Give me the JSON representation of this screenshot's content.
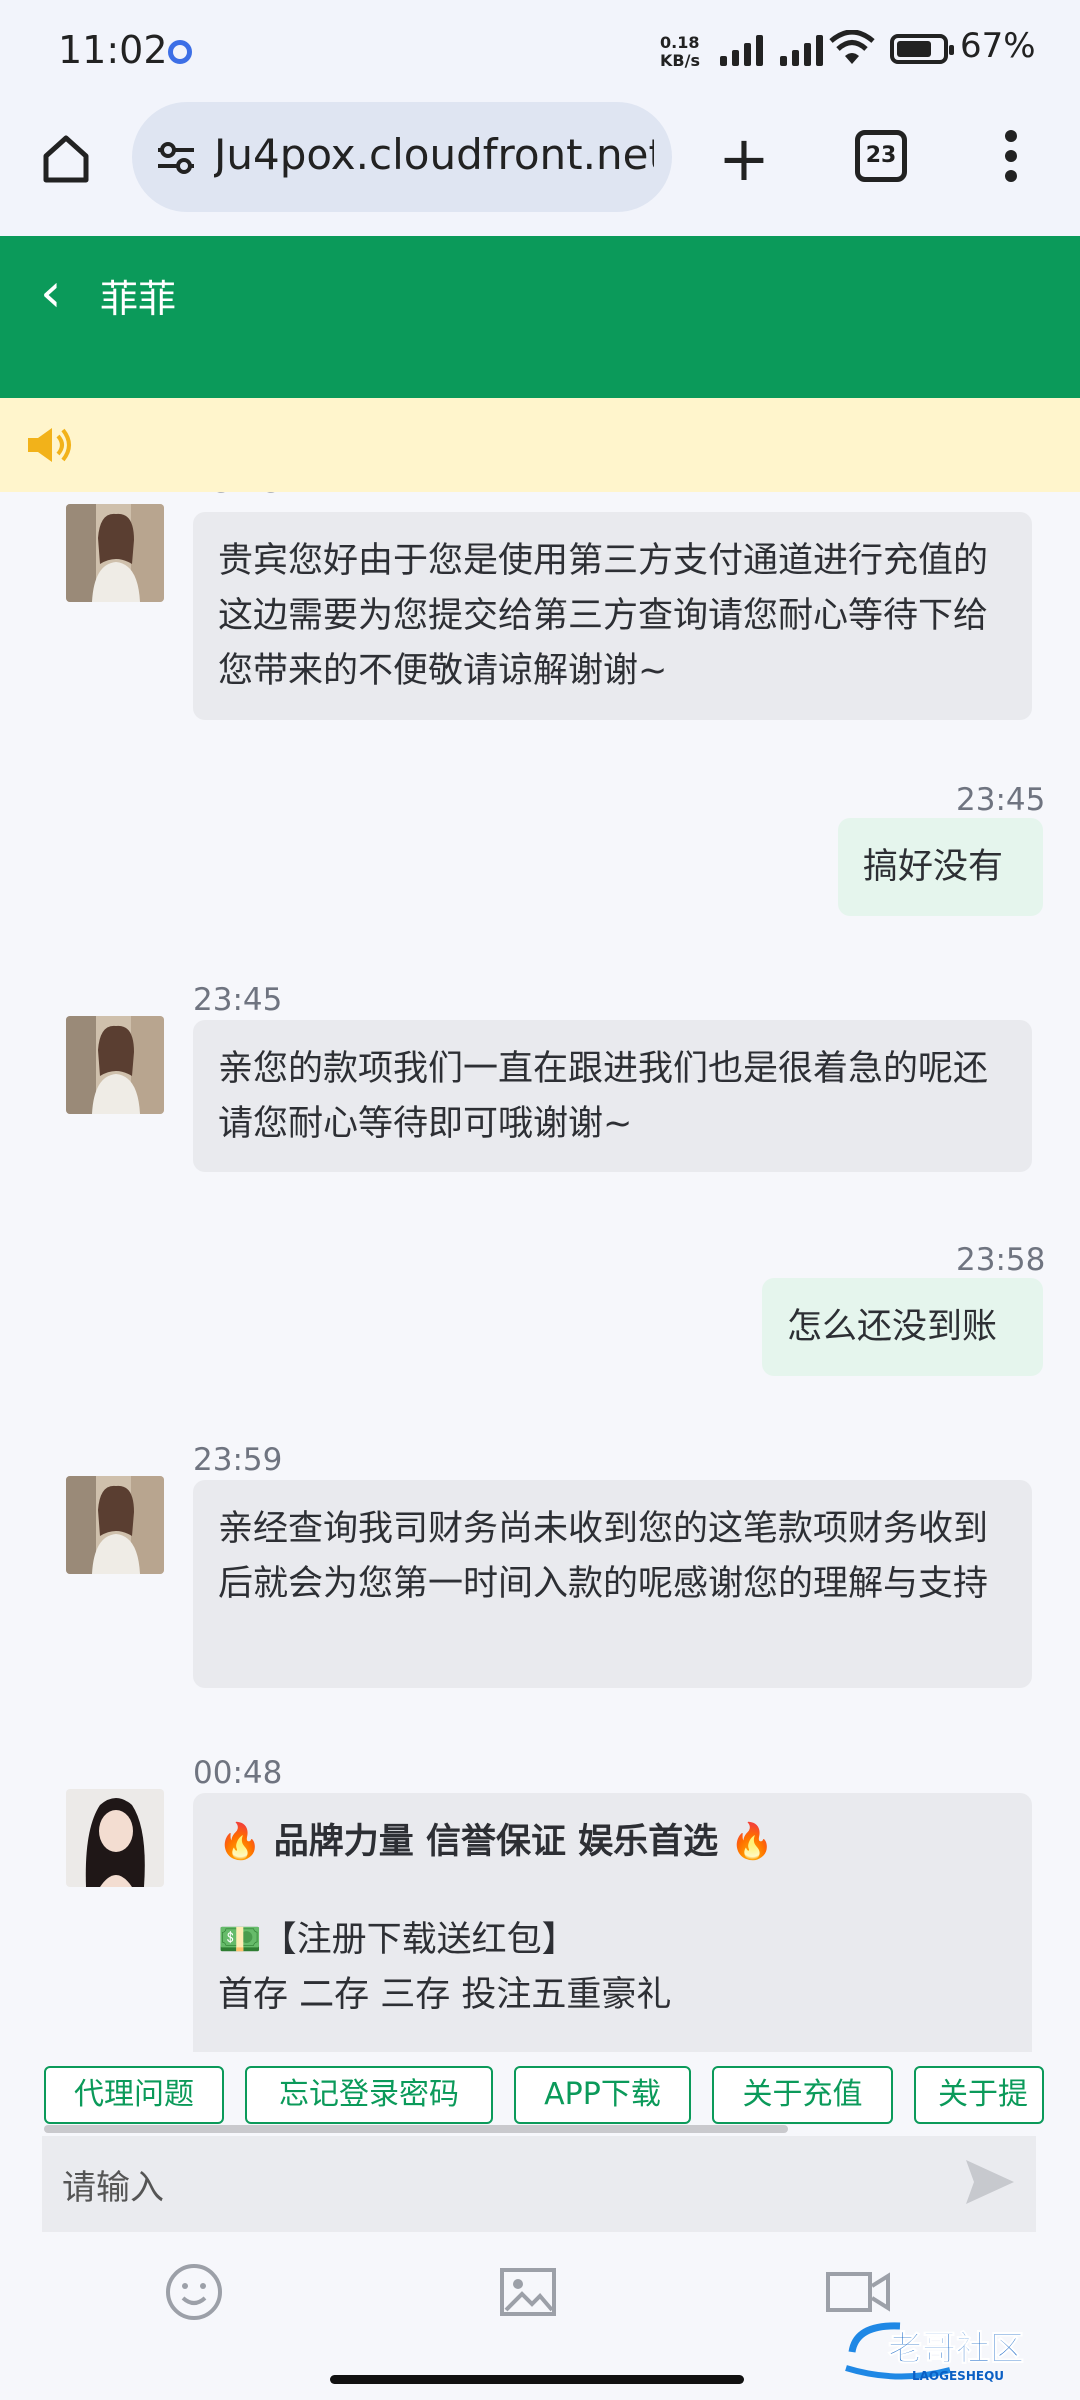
{
  "status": {
    "time": "11:02",
    "net_speed_top": "0.18",
    "net_speed_unit": "KB/s",
    "battery": "67%"
  },
  "browser": {
    "url": "Ju4pox.cloudfront.net",
    "tab_count": "23"
  },
  "chat": {
    "title": "菲菲",
    "messages": [
      {
        "time": "23:45",
        "text": "贵宾您好由于您是使用第三方支付通道进行充值的这边需要为您提交给第三方查询请您耐心等待下给您带来的不便敬请谅解谢谢~"
      },
      {
        "time": "23:45",
        "text": "搞好没有"
      },
      {
        "time": "23:45",
        "text": "亲您的款项我们一直在跟进我们也是很着急的呢还请您耐心等待即可哦谢谢~"
      },
      {
        "time": "23:58",
        "text": "怎么还没到账"
      },
      {
        "time": "23:59",
        "text": "亲经查询我司财务尚未收到您的这笔款项财务收到后就会为您第一时间入款的呢感谢您的理解与支持"
      },
      {
        "time": "00:48",
        "line1": "🔥 品牌力量 信誉保证 娱乐首选 🔥",
        "line2": "💵【注册下载送红包】",
        "line3": "首存 二存 三存 投注五重豪礼"
      }
    ]
  },
  "quick_replies": [
    "代理问题",
    "忘记登录密码",
    "APP下载",
    "关于充值",
    "关于提"
  ],
  "input": {
    "placeholder": "请输入"
  },
  "watermark": {
    "text": "老哥社区",
    "subtext": "LAOGESHEQU"
  },
  "colors": {
    "accent": "#0b9a5a",
    "notice_bg": "#fff5cc",
    "my_bubble": "#e5f5ed",
    "their_bubble": "#e9eaee"
  }
}
